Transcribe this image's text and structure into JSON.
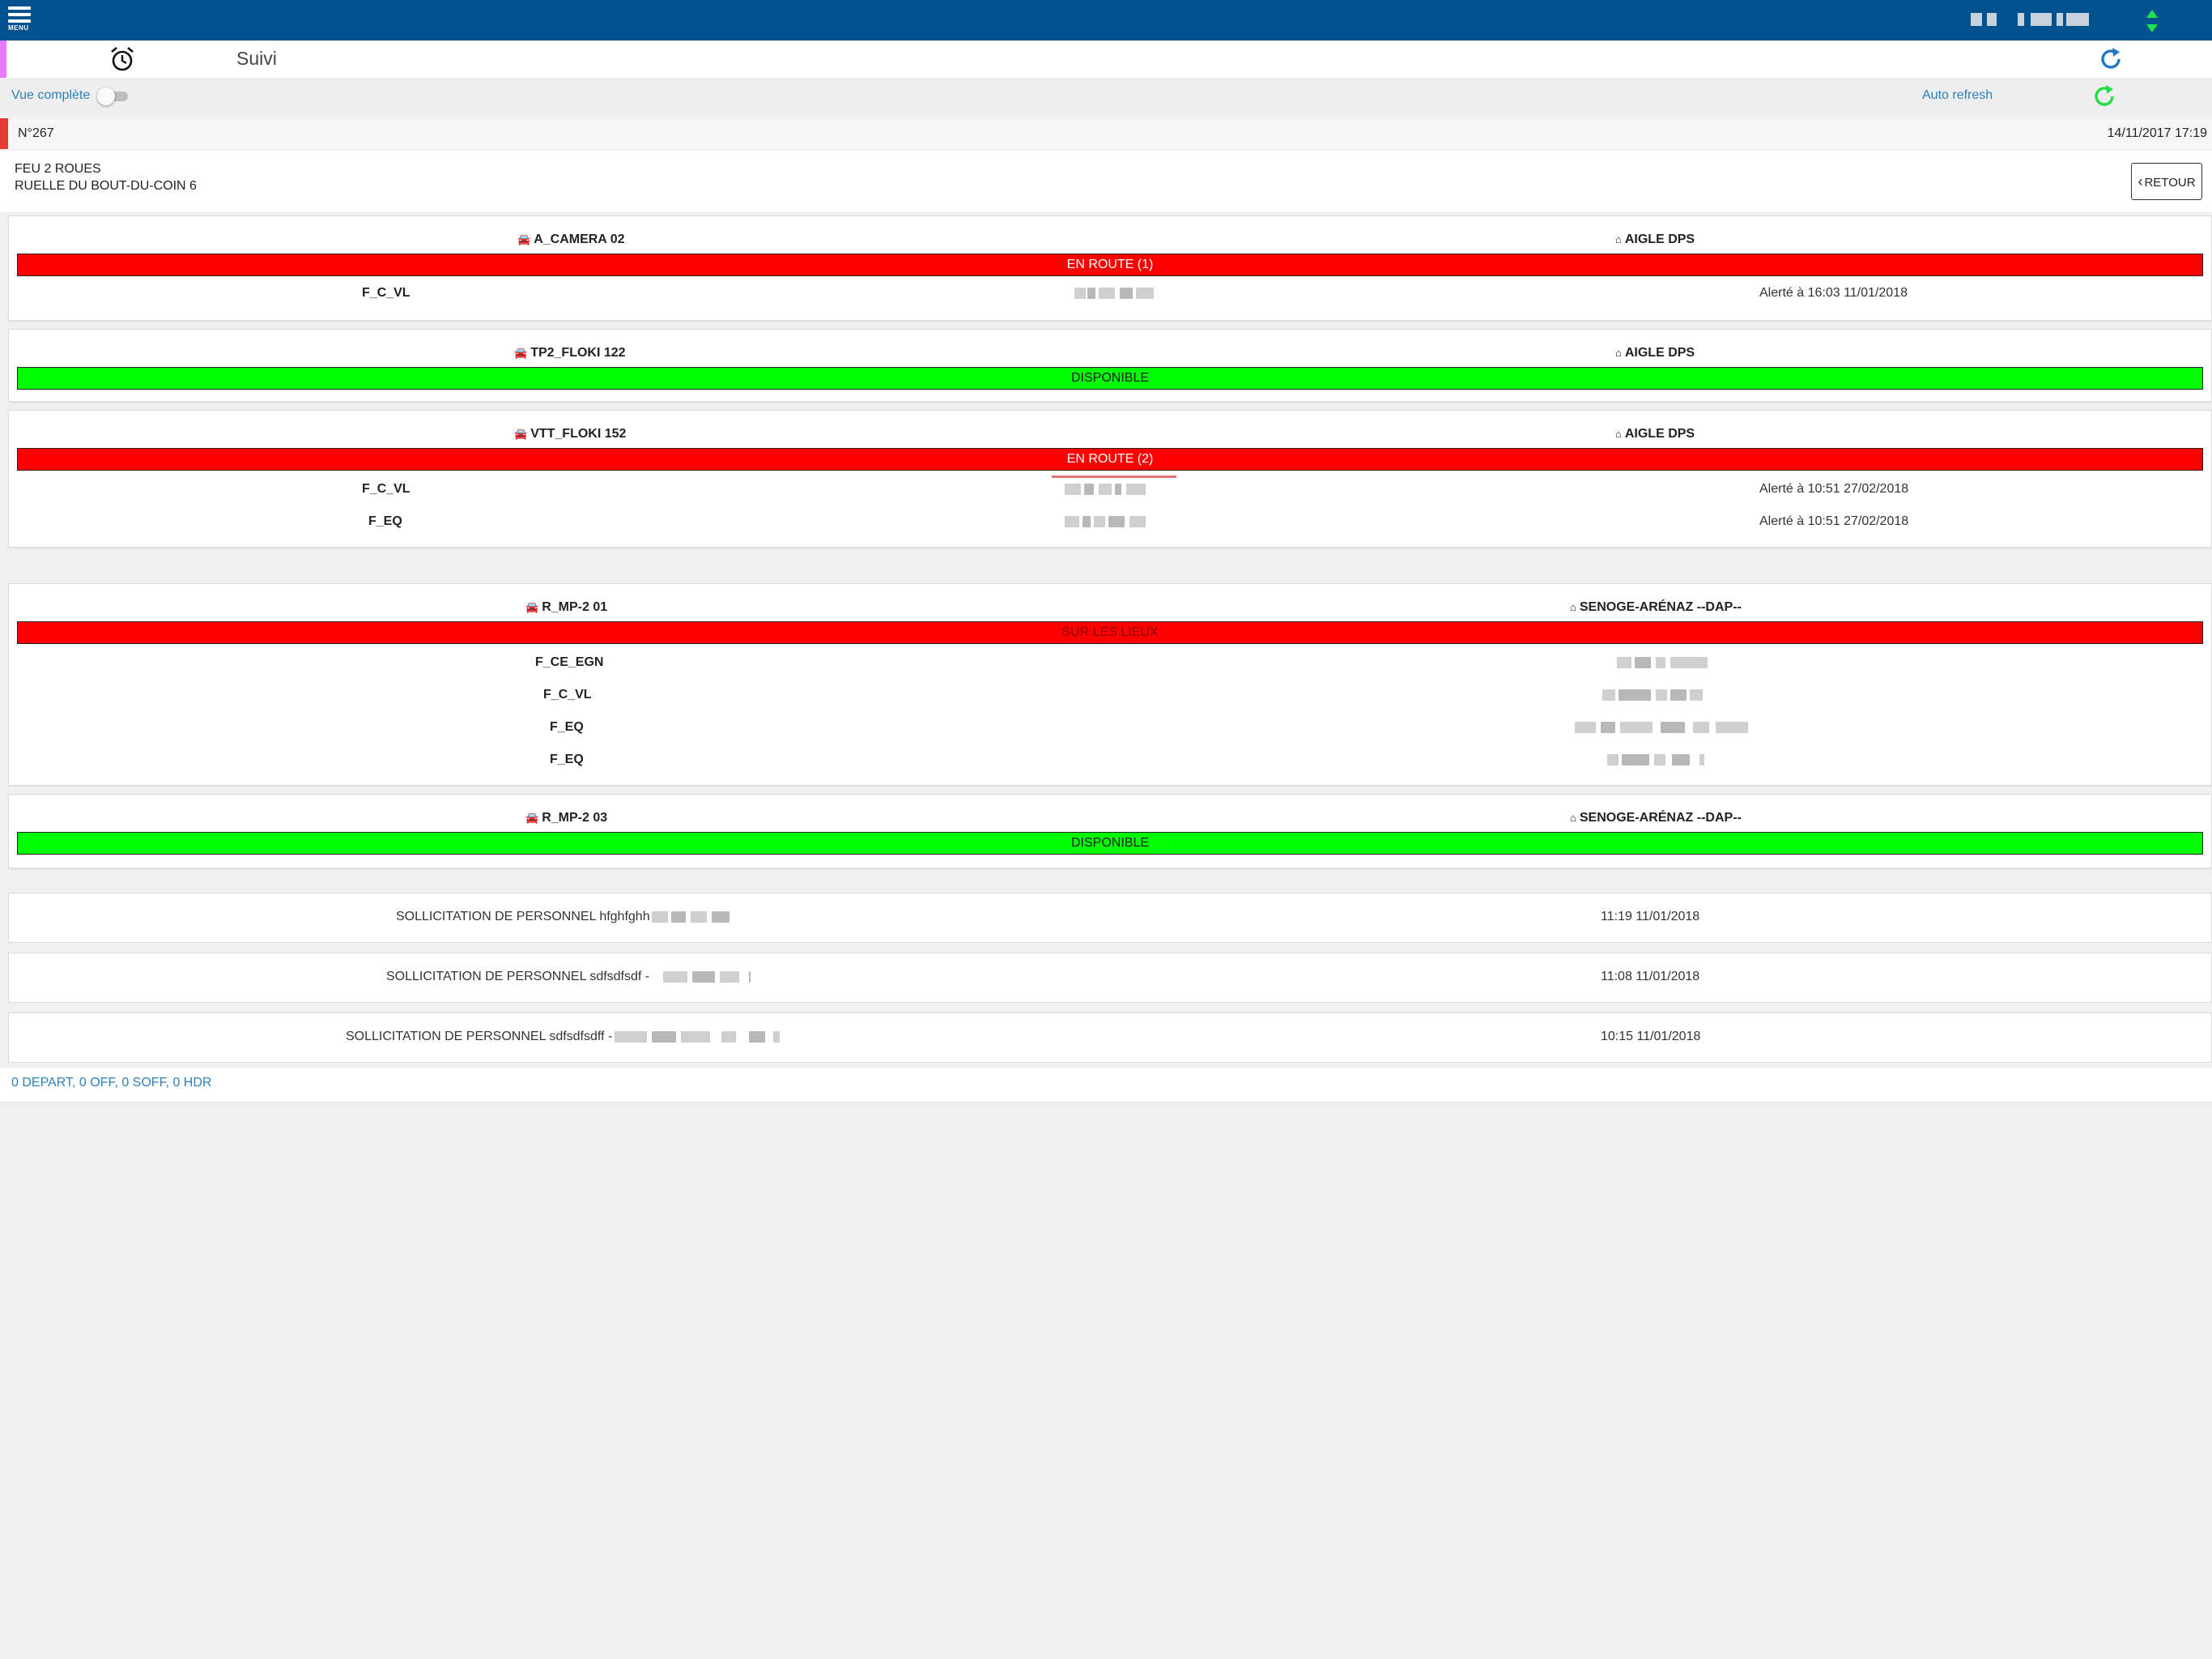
{
  "topbar": {
    "menu_label": "MENU",
    "color": "#02528f"
  },
  "page": {
    "title": "Suivi",
    "icons": [
      "alarm-clock-icon",
      "refresh-icon",
      "sort-updown-icon"
    ]
  },
  "controls": {
    "vue_complete_label": "Vue complète",
    "vue_complete_on": false,
    "auto_refresh_label": "Auto refresh"
  },
  "incident": {
    "number": "N°267",
    "datetime": "14/11/2017 17:19",
    "type": "FEU 2 ROUES",
    "address": "RUELLE DU BOUT-DU-COIN 6",
    "back_label": "RETOUR"
  },
  "vehicles": [
    {
      "name": "A_CAMERA 02",
      "site": "AIGLE DPS",
      "status": "EN ROUTE (1)",
      "status_color": "#ff0000",
      "crew": [
        {
          "role": "F_C_VL",
          "alert": "Alerté à 16:03 11/01/2018"
        }
      ]
    },
    {
      "name": "TP2_FLOKI 122",
      "site": "AIGLE DPS",
      "status": "DISPONIBLE",
      "status_color": "#00ff00",
      "crew": []
    },
    {
      "name": "VTT_FLOKI 152",
      "site": "AIGLE DPS",
      "status": "EN ROUTE (2)",
      "status_color": "#ff0000",
      "crew": [
        {
          "role": "F_C_VL",
          "alert": "Alerté à 10:51 27/02/2018"
        },
        {
          "role": "F_EQ",
          "alert": "Alerté à 10:51 27/02/2018"
        }
      ]
    },
    {
      "name": "R_MP-2 01",
      "site": "SENOGE-ARÉNAZ --DAP--",
      "status": "SUR LES LIEUX",
      "status_color": "#ff0000",
      "crew": [
        {
          "role": "F_CE_EGN"
        },
        {
          "role": "F_C_VL"
        },
        {
          "role": "F_EQ"
        },
        {
          "role": "F_EQ"
        }
      ]
    },
    {
      "name": "R_MP-2 03",
      "site": "SENOGE-ARÉNAZ --DAP--",
      "status": "DISPONIBLE",
      "status_color": "#00ff00",
      "crew": []
    }
  ],
  "sollicitations": [
    {
      "text": "SOLLICITATION DE PERSONNEL hfghfghh -",
      "time": "11:19 11/01/2018"
    },
    {
      "text": "SOLLICITATION DE PERSONNEL sdfsdfsdf -",
      "time": "11:08 11/01/2018"
    },
    {
      "text": "SOLLICITATION DE PERSONNEL sdfsdfsdff -",
      "time": "10:15 11/01/2018"
    }
  ],
  "summary": "0 DEPART, 0 OFF, 0 SOFF, 0 HDR"
}
